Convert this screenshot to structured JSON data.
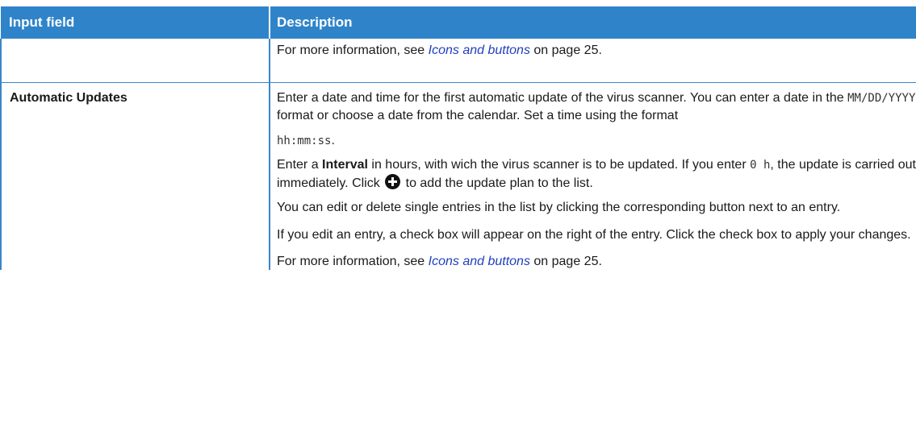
{
  "table": {
    "header": {
      "field": "Input field",
      "description": "Description"
    },
    "row1": {
      "field": "",
      "info_prefix": "For more information, see ",
      "info_link": "Icons and buttons",
      "info_suffix": " on page 25."
    },
    "row2": {
      "field": "Automatic Updates",
      "p1_a": "Enter a date and time for the first automatic update of the virus scanner. You can enter a date in the ",
      "p1_format": "MM/DD/YYYY",
      "p1_b": " format or choose a date from the calendar. Set a time using the format ",
      "p1_time": "hh:mm:ss",
      "p1_c": ".",
      "p2_a": "Enter a ",
      "p2_bold": "Interval",
      "p2_b": " in hours, with wich the virus scanner is to be updated. If you enter ",
      "p2_code": "0 h",
      "p2_c": ", the update is carried out immediately. Click ",
      "p2_d": " to add the update plan to the list.",
      "p3": "You can edit or delete single entries in the list by clicking the corresponding button next to an entry.",
      "p4": "If you edit an entry, a check box will appear on the right of the entry. Click the check box to apply your changes.",
      "info_prefix": "For more information, see ",
      "info_link": "Icons and buttons",
      "info_suffix": " on page 25."
    },
    "plus_icon": "plus-circle-icon"
  }
}
